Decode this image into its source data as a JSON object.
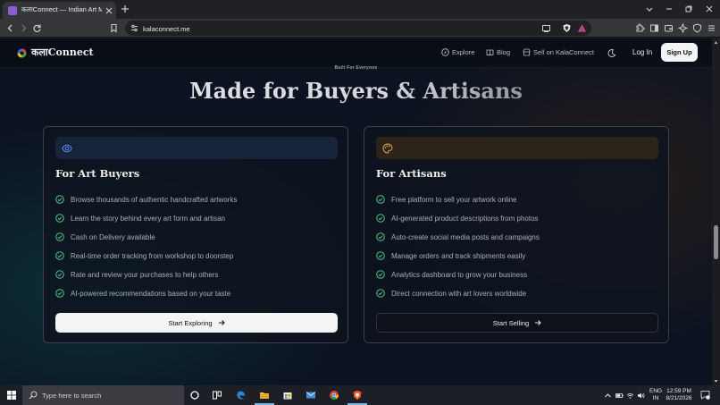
{
  "browser": {
    "tab_title": "कलाConnect — Indian Art Marketplace",
    "url": "kalaconnect.me"
  },
  "site": {
    "logo_text": "कलाConnect",
    "nav": {
      "explore": "Explore",
      "blog": "Blog",
      "sell": "Sell on KalaConnect",
      "login": "Log In",
      "signup": "Sign Up"
    },
    "eyebrow": "Built For Everyone",
    "heading": "Made for Buyers & Artisans",
    "cards": [
      {
        "title": "For Art Buyers",
        "features": [
          "Browse thousands of authentic handcrafted artworks",
          "Learn the story behind every art form and artisan",
          "Cash on Delivery available",
          "Real-time order tracking from workshop to doorstep",
          "Rate and review your purchases to help others",
          "AI-powered recommendations based on your taste"
        ],
        "cta": "Start Exploring"
      },
      {
        "title": "For Artisans",
        "features": [
          "Free platform to sell your artwork online",
          "AI-generated product descriptions from photos",
          "Auto-create social media posts and campaigns",
          "Manage orders and track shipments easily",
          "Analytics dashboard to grow your business",
          "Direct connection with art lovers worldwide"
        ],
        "cta": "Start Selling"
      }
    ]
  },
  "taskbar": {
    "search_placeholder": "Type here to search",
    "lang_1": "ENG",
    "lang_2": "IN",
    "time": "12:59 PM",
    "date": "8/21/2026"
  },
  "colors": {
    "check_green": "#4cc38a",
    "buyers_icon": "#5b8def",
    "artisans_icon": "#e8b04a"
  }
}
